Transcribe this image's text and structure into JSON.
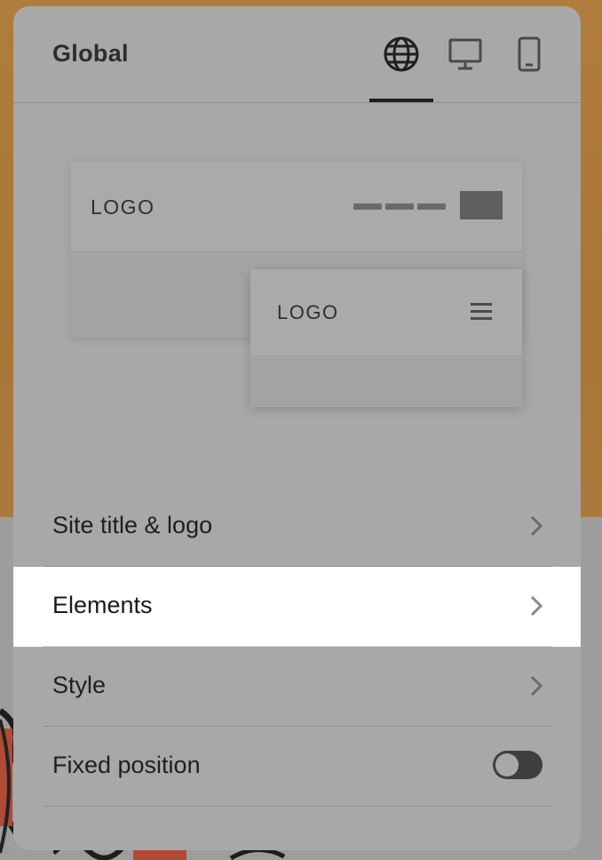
{
  "panel": {
    "title": "Global",
    "tabs": [
      {
        "id": "global",
        "icon": "globe-icon",
        "active": true
      },
      {
        "id": "desktop",
        "icon": "desktop-icon",
        "active": false
      },
      {
        "id": "mobile",
        "icon": "mobile-icon",
        "active": false
      }
    ]
  },
  "preview": {
    "desktop_logo": "LOGO",
    "mobile_logo": "LOGO"
  },
  "menu": {
    "items": [
      {
        "label": "Site title & logo",
        "icon": "chevron-right-icon"
      },
      {
        "label": "Elements",
        "icon": "chevron-right-icon",
        "active": true
      },
      {
        "label": "Style",
        "icon": "chevron-right-icon"
      },
      {
        "label": "Fixed position",
        "toggle": false
      }
    ]
  },
  "colors": {
    "panel_bg": "#a8a8a8",
    "active_row_bg": "#ffffff",
    "text": "#1f1f1f",
    "background_accent": "#b07d3c"
  }
}
